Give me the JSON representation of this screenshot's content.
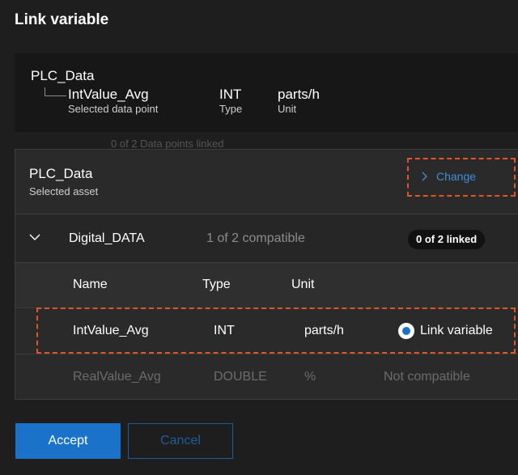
{
  "dialog": {
    "title": "Link variable"
  },
  "datapoint": {
    "parent": "PLC_Data",
    "name": "IntValue_Avg",
    "name_label": "Selected data point",
    "type": "INT",
    "type_label": "Type",
    "unit": "parts/h",
    "unit_label": "Unit"
  },
  "background_text": "0 of 2 Data points linked",
  "asset": {
    "name": "PLC_Data",
    "label": "Selected asset",
    "change_label": "Change"
  },
  "group": {
    "name": "Digital_DATA",
    "compatible": "1 of 2 compatible",
    "linked_badge": "0 of 2 linked"
  },
  "table": {
    "headers": {
      "name": "Name",
      "type": "Type",
      "unit": "Unit"
    },
    "rows": [
      {
        "name": "IntValue_Avg",
        "type": "INT",
        "unit": "parts/h",
        "action": "Link variable",
        "selected": true
      },
      {
        "name": "RealValue_Avg",
        "type": "DOUBLE",
        "unit": "%",
        "action": "Not compatible",
        "selected": false
      }
    ]
  },
  "buttons": {
    "accept": "Accept",
    "cancel": "Cancel"
  },
  "colors": {
    "accent": "#1a73c9",
    "highlight": "#e0552a",
    "background": "#1e1e1e"
  }
}
